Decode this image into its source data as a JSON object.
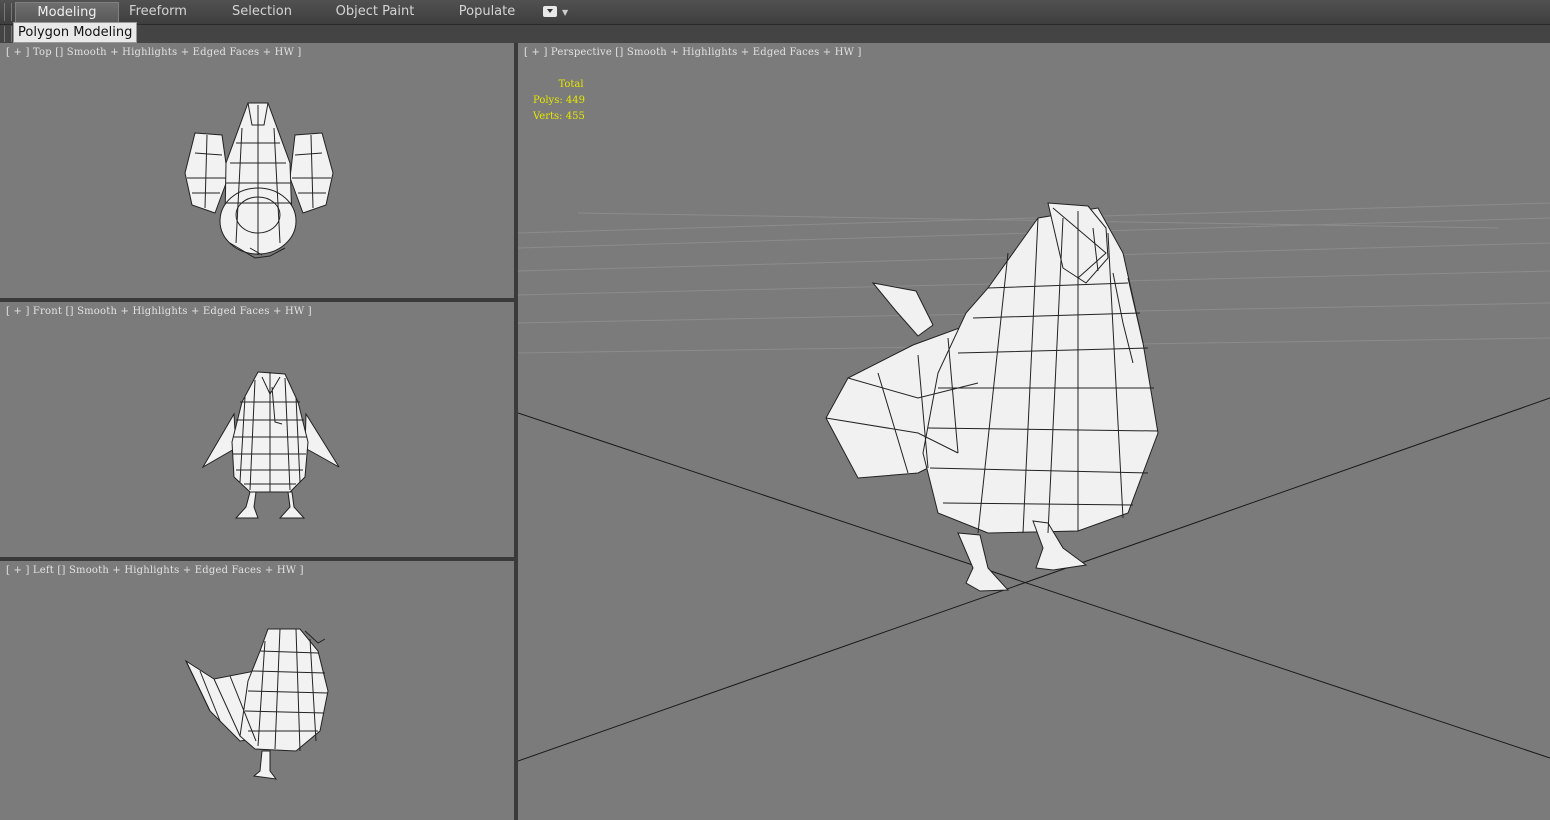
{
  "ribbon": {
    "tabs": [
      {
        "label": "Modeling",
        "active": true
      },
      {
        "label": "Freeform",
        "active": false
      },
      {
        "label": "Selection",
        "active": false
      },
      {
        "label": "Object Paint",
        "active": false
      },
      {
        "label": "Populate",
        "active": false
      }
    ],
    "panel_label": "Polygon Modeling"
  },
  "viewports": {
    "top": {
      "label": "[ + ] Top [] Smooth + Highlights + Edged Faces + HW ]"
    },
    "front": {
      "label": "[ + ] Front [] Smooth + Highlights + Edged Faces + HW ]"
    },
    "left": {
      "label": "[ + ] Left [] Smooth + Highlights + Edged Faces + HW ]"
    },
    "perspective": {
      "label": "[ + ] Perspective [] Smooth + Highlights + Edged Faces + HW ]",
      "stats": {
        "header": "Total",
        "polys_label": "Polys:",
        "polys": "449",
        "verts_label": "Verts:",
        "verts": "455"
      }
    }
  },
  "colors": {
    "viewport_bg": "#7b7b7b",
    "stats_text": "#e6e600",
    "ui_dark": "#3a3a3a"
  }
}
